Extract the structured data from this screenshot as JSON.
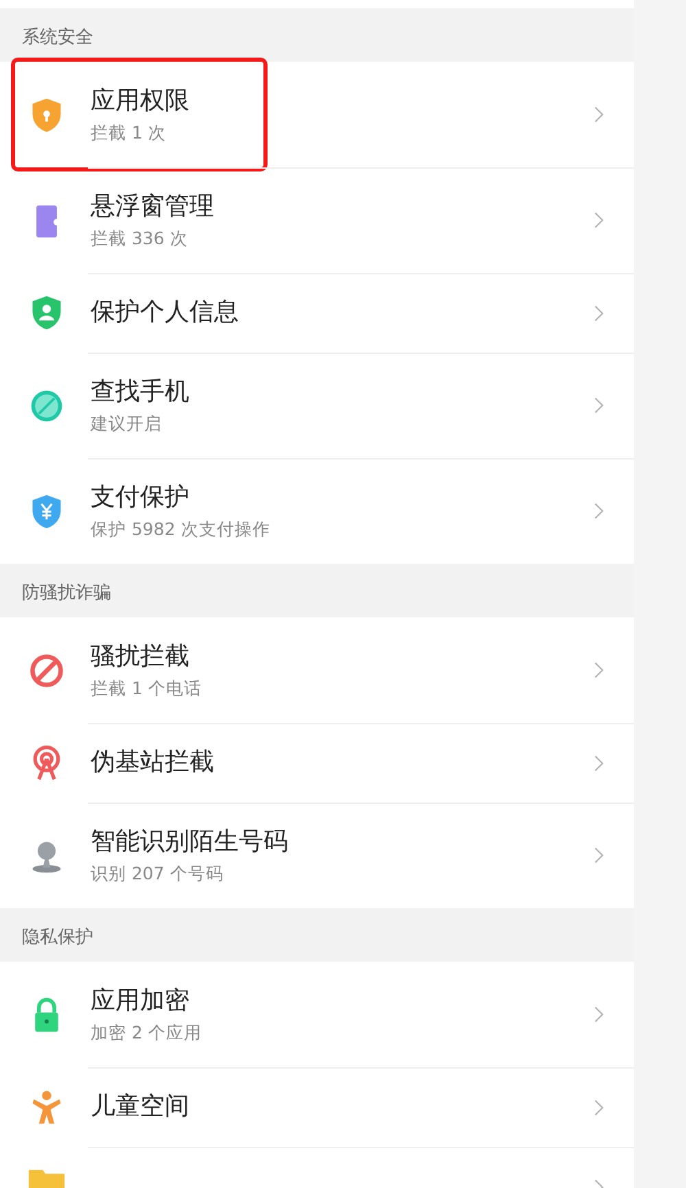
{
  "sections": [
    {
      "title": "系统安全",
      "items": [
        {
          "title": "应用权限",
          "subtitle": "拦截 1 次",
          "highlighted": true
        },
        {
          "title": "悬浮窗管理",
          "subtitle": "拦截 336 次",
          "highlighted": false
        },
        {
          "title": "保护个人信息",
          "highlighted": false
        },
        {
          "title": "查找手机",
          "subtitle": "建议开启",
          "highlighted": false
        },
        {
          "title": "支付保护",
          "subtitle": "保护 5982 次支付操作",
          "highlighted": false
        }
      ]
    },
    {
      "title": "防骚扰诈骗",
      "items": [
        {
          "title": "骚扰拦截",
          "subtitle": "拦截 1 个电话",
          "highlighted": false
        },
        {
          "title": "伪基站拦截",
          "highlighted": false
        },
        {
          "title": "智能识别陌生号码",
          "subtitle": "识别 207 个号码",
          "highlighted": false
        }
      ]
    },
    {
      "title": "隐私保护",
      "items": [
        {
          "title": "应用加密",
          "subtitle": "加密 2 个应用",
          "highlighted": false
        },
        {
          "title": "儿童空间",
          "highlighted": false
        },
        {
          "highlighted": false
        }
      ]
    }
  ]
}
